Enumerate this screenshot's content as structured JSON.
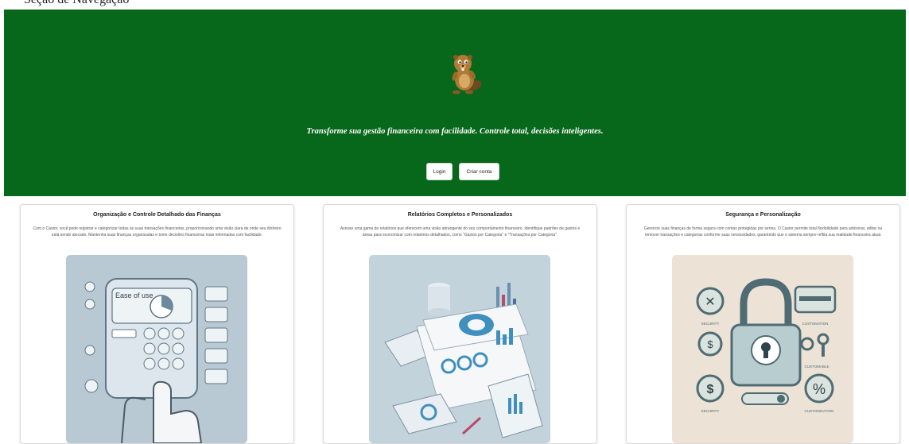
{
  "page": {
    "cut_off_heading": "Seção de Navegação"
  },
  "hero": {
    "mascot": "beaver-mascot-icon",
    "tagline": "Transforme sua gestão financeira com facilidade. Controle total, decisões inteligentes.",
    "login_label": "Login",
    "create_account_label": "Criar conta"
  },
  "colors": {
    "hero_bg": "#07671a",
    "card_border": "#d9d9d9",
    "illustration_bg_blue": "#b7c8d2",
    "illustration_bg_beige": "#ece3d6"
  },
  "cards": [
    {
      "title": "Organização e Controle Detalhado das Finanças",
      "description": "Com o Castor, você pode registrar e categorizar todas as suas transações financeiras, proporcionando uma visão clara de onde seu dinheiro está sendo alocado. Mantenha suas finanças organizadas e tome decisões financeiras mais informadas com facilidade.",
      "image": "ease-of-use-illustration",
      "image_text": "Ease of use"
    },
    {
      "title": "Relatórios Completos e Personalizados",
      "description": "Acesse uma gama de relatórios que oferecem uma visão abrangente do seu comportamento financeiro. Identifique padrões de gastos e áreas para economizar com relatórios detalhados, como \"Gastos por Categoria\" e \"Transações por Categoria\".",
      "image": "reports-illustration"
    },
    {
      "title": "Segurança e Personalização",
      "description": "Gerencie suas finanças de forma segura com contas protegidas por senha. O Castor permite total flexibilidade para adicionar, editar ou remover transações e categorias conforme suas necessidades, garantindo que o sistema sempre reflita sua realidade financeira atual.",
      "image": "security-illustration",
      "image_labels": [
        "SECURITY",
        "CUSTOMATION",
        "CUSTOMABLE",
        "CUSTOMIZATION"
      ]
    }
  ]
}
